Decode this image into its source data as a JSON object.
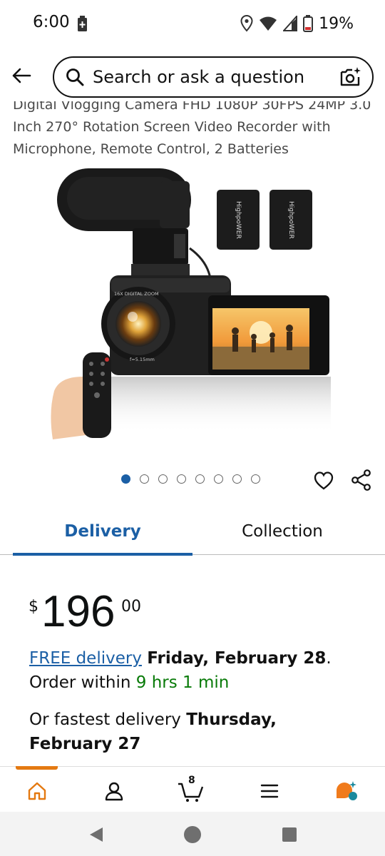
{
  "status_bar": {
    "time": "6:00",
    "battery": "19%",
    "icons": [
      "battery-saver-icon",
      "location-icon",
      "wifi-icon",
      "signal-icon",
      "battery-icon"
    ]
  },
  "header": {
    "back_icon": "back-arrow-icon",
    "search_placeholder": "Search or ask a question",
    "camera_icon": "camera-search-icon"
  },
  "product": {
    "title": "Digital Vlogging Camera FHD 1080P 30FPS 24MP 3.0 Inch 270° Rotation Screen Video Recorder with Microphone, Remote Control, 2 Batteries",
    "image_labels": {
      "battery_text": "HighpoWER",
      "lens_text": "16X DIGITAL ZOOM",
      "lens_spec": "f=5.15mm"
    },
    "carousel": {
      "total": 8,
      "active": 0
    },
    "actions": [
      "heart-icon",
      "share-icon"
    ]
  },
  "tabs": [
    {
      "label": "Delivery",
      "active": true
    },
    {
      "label": "Collection",
      "active": false
    }
  ],
  "price": {
    "symbol": "$",
    "whole": "196",
    "fraction": "00"
  },
  "delivery": {
    "free_label": "FREE delivery",
    "date": "Friday, February 28",
    "date_suffix": ".",
    "order_within_label": "Order within",
    "countdown": "9 hrs 1 min",
    "fastest_label": "Or fastest delivery",
    "fastest_date": "Thursday, February 27"
  },
  "bottom_nav": {
    "items": [
      "home-icon",
      "account-icon",
      "cart-icon",
      "menu-icon",
      "rufus-icon"
    ],
    "cart_count": "8"
  },
  "colors": {
    "link": "#1b5fa5",
    "accent": "#e47911",
    "green": "#087a08"
  }
}
